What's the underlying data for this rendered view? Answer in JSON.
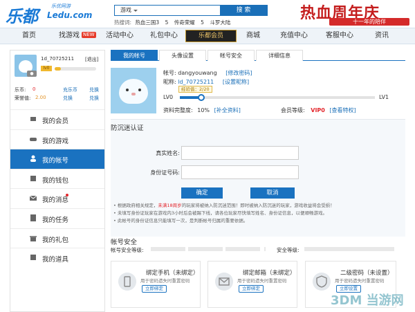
{
  "header": {
    "logo_text": "乐都",
    "logo_domain": "Ledu.com",
    "logo_slogan": "乐优网游",
    "search_category": "游戏",
    "search_button": "搜 索",
    "hot_label": "热搜词:",
    "hot_terms": [
      "热血三国3",
      "5",
      "传奇荣耀",
      "5",
      "斗罗大陆"
    ],
    "banner_title": "热血周年庆",
    "banner_sub": "十一年的陪伴"
  },
  "nav": {
    "items": [
      "首页",
      "找游戏",
      "活动中心",
      "礼包中心",
      "商城",
      "充值中心",
      "客服中心",
      "资讯"
    ],
    "new_badge": "NEW",
    "brand": "乐都会员"
  },
  "user": {
    "name": "1d_70725211",
    "logout": "[退出]",
    "level_badge": "lv0",
    "level_progress": 0.15,
    "coins_label": "乐币:",
    "coins_value": "0",
    "coins_link1": "充乐币",
    "coins_link2": "兑换",
    "honor_label": "荣誉值:",
    "honor_value": "2.00",
    "honor_link1": "兑换",
    "honor_link2": "兑换"
  },
  "sidebar": {
    "items": [
      {
        "label": "我的会员",
        "icon": "member-icon"
      },
      {
        "label": "我的游戏",
        "icon": "gamepad-icon"
      },
      {
        "label": "我的帐号",
        "icon": "user-icon"
      },
      {
        "label": "我的钱包",
        "icon": "wallet-icon"
      },
      {
        "label": "我的消息",
        "icon": "mail-icon"
      },
      {
        "label": "我的任务",
        "icon": "task-icon"
      },
      {
        "label": "我的礼包",
        "icon": "gift-icon"
      },
      {
        "label": "我的道具",
        "icon": "item-icon"
      }
    ],
    "active_index": 2
  },
  "tabs": [
    "我的帐号",
    "头像设置",
    "帐号安全",
    "详细信息"
  ],
  "account": {
    "account_label": "帐号:",
    "account_value": "dangyouwang",
    "edit_password": "[修改密码]",
    "nick_label": "昵称:",
    "nick_value": "ld_70725211",
    "edit_nick": "[设置昵称]",
    "exp_tip": "经验值：2/20",
    "exp_progress": 0.1,
    "lv_start": "LV0",
    "lv_end": "LV1",
    "completeness_label": "资料完整度:",
    "completeness_value": "10%",
    "complete_link": "[补全资料]",
    "member_label": "会员等级:",
    "member_value": "VIP0",
    "member_link": "[查看特权]"
  },
  "anti_addiction": {
    "title": "防沉迷认证",
    "name_label": "真实姓名:",
    "id_label": "身份证号码:",
    "confirm": "确定",
    "cancel": "取消",
    "note1_a": "根据政府相关规定，",
    "note1_red": "未满18周岁",
    "note1_b": "的玩家将被纳入防沉迷范围！即时被纳入防沉迷的玩家，游戏收益将会受损！",
    "note2": "未填写身份证玩家在游戏内3小时后会被踢下线，请各位玩家尽快填写姓名、身份证信息，以便顺畅游戏。",
    "note3": "此帐号的身份证信息只能填写一次，是判断帐号归属的重要依据。"
  },
  "security": {
    "title": "帐号安全",
    "level_label": "帐号安全等级:",
    "level_text": "安全等级:",
    "cards": [
      {
        "title": "绑定手机（未绑定）",
        "desc": "用于密码遗失时重置密码",
        "action": "立即绑定",
        "icon": "phone-icon"
      },
      {
        "title": "绑定邮箱（未绑定）",
        "desc": "用于密码遗失时重置密码",
        "action": "立即绑定",
        "icon": "email-icon"
      },
      {
        "title": "二级密码（未设置）",
        "desc": "用于密码遗失时重置密码",
        "action": "立即设置",
        "icon": "shield-icon"
      }
    ]
  },
  "watermark": "3DM 当游网",
  "colors": {
    "primary": "#1a72c0",
    "alert": "#e3252b",
    "brand_red": "#c41d1d"
  }
}
